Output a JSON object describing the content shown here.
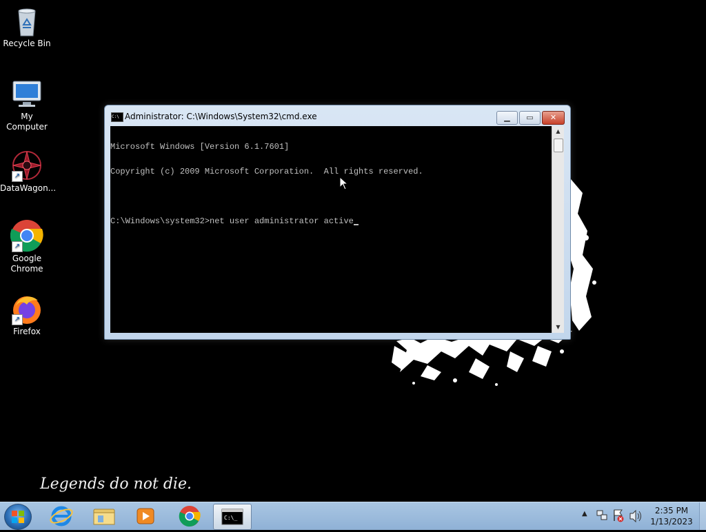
{
  "desktop": {
    "icons": [
      {
        "label": "Recycle Bin",
        "icon": "recycle-bin-icon"
      },
      {
        "label": "My Computer",
        "icon": "computer-icon"
      },
      {
        "label": "DataWagon...",
        "icon": "datawagon-icon"
      },
      {
        "label": "Google Chrome",
        "line1": "Google",
        "line2": "Chrome",
        "icon": "chrome-icon"
      },
      {
        "label": "Firefox",
        "icon": "firefox-icon"
      }
    ],
    "wallpaper_text": "Legends do not die."
  },
  "window": {
    "title": "Administrator: C:\\Windows\\System32\\cmd.exe",
    "buttons": {
      "minimize": "minimize-icon",
      "maximize": "maximize-icon",
      "close": "close-icon"
    },
    "console_lines": [
      "Microsoft Windows [Version 6.1.7601]",
      "Copyright (c) 2009 Microsoft Corporation.  All rights reserved.",
      "",
      "C:\\Windows\\system32>net user administrator active"
    ]
  },
  "taskbar": {
    "pinned": [
      "internet-explorer-icon",
      "file-explorer-icon",
      "media-player-icon",
      "chrome-icon",
      "cmd-icon"
    ],
    "active": "cmd-icon",
    "tray_icons": [
      "show-hidden-icons-arrow",
      "network-icon",
      "action-center-icon",
      "volume-icon"
    ],
    "time": "2:35 PM",
    "date": "1/13/2023"
  },
  "colors": {
    "desktop_bg": "#000000",
    "taskbar": "#9dbddf",
    "console_text": "#c0c0c0",
    "close_button": "#c7412a"
  }
}
